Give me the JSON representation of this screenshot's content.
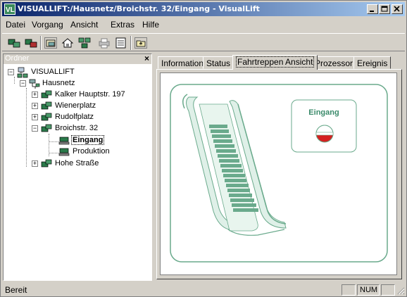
{
  "window": {
    "title": "VISUALLIFT:/Hausnetz/Broichstr. 32/Eingang - VisualLift"
  },
  "menu": [
    {
      "label": "Datei"
    },
    {
      "label": "Vorgang"
    },
    {
      "label": "Ansicht"
    },
    {
      "label": "Extras"
    },
    {
      "label": "Hilfe"
    }
  ],
  "tree": {
    "header": "Ordner",
    "root": "VISUALLIFT",
    "network": "Hausnetz",
    "items": [
      {
        "label": "Kalker Hauptstr. 197"
      },
      {
        "label": "Wienerplatz"
      },
      {
        "label": "Rudolfplatz"
      },
      {
        "label": "Broichstr. 32"
      },
      {
        "label": "Eingang"
      },
      {
        "label": "Produktion"
      },
      {
        "label": "Hohe Straße"
      }
    ]
  },
  "tabs": [
    {
      "label": "Information"
    },
    {
      "label": "Status"
    },
    {
      "label": "Fahrtreppen Ansicht"
    },
    {
      "label": "Prozessor"
    },
    {
      "label": "Ereignis"
    }
  ],
  "active_tab": "Fahrtreppen Ansicht",
  "view": {
    "entry_label": "Eingang"
  },
  "status": {
    "text": "Bereit",
    "num": "NUM"
  },
  "colors": {
    "accent_green": "#6aaa8c",
    "stop_red": "#d42020"
  }
}
